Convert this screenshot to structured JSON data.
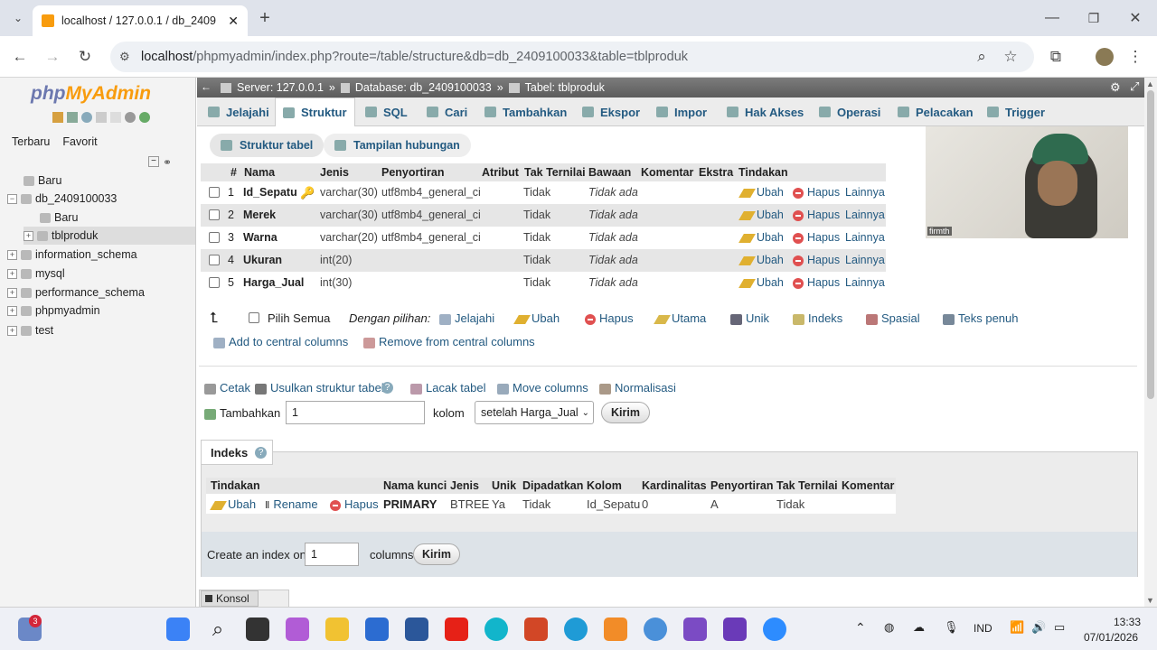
{
  "browser": {
    "tab_title": "localhost / 127.0.0.1 / db_2409",
    "url_host": "localhost",
    "url_path": "/phpmyadmin/index.php?route=/table/structure&db=db_2409100033&table=tblproduk"
  },
  "sidebar": {
    "logo_php": "php",
    "logo_my": "MyAdmin",
    "tabs": [
      "Terbaru",
      "Favorit"
    ],
    "tree": [
      "Baru",
      "db_2409100033",
      "Baru",
      "tblproduk",
      "information_schema",
      "mysql",
      "performance_schema",
      "phpmyadmin",
      "test"
    ]
  },
  "breadcrumb": {
    "server": "Server: 127.0.0.1",
    "database": "Database: db_2409100033",
    "table": "Tabel: tblproduk",
    "sep": "»"
  },
  "menu": [
    "Jelajahi",
    "Struktur",
    "SQL",
    "Cari",
    "Tambahkan",
    "Ekspor",
    "Impor",
    "Hak Akses",
    "Operasi",
    "Pelacakan",
    "Trigger"
  ],
  "subtabs": [
    "Struktur tabel",
    "Tampilan hubungan"
  ],
  "structure": {
    "headers": [
      "#",
      "Nama",
      "Jenis",
      "Penyortiran",
      "Atribut",
      "Tak Ternilai",
      "Bawaan",
      "Komentar",
      "Ekstra",
      "Tindakan"
    ],
    "rows": [
      {
        "num": "1",
        "name": "Id_Sepatu",
        "type": "varchar(30)",
        "collation": "utf8mb4_general_ci",
        "null": "Tidak",
        "default": "Tidak ada"
      },
      {
        "num": "2",
        "name": "Merek",
        "type": "varchar(30)",
        "collation": "utf8mb4_general_ci",
        "null": "Tidak",
        "default": "Tidak ada"
      },
      {
        "num": "3",
        "name": "Warna",
        "type": "varchar(20)",
        "collation": "utf8mb4_general_ci",
        "null": "Tidak",
        "default": "Tidak ada"
      },
      {
        "num": "4",
        "name": "Ukuran",
        "type": "int(20)",
        "collation": "",
        "null": "Tidak",
        "default": "Tidak ada"
      },
      {
        "num": "5",
        "name": "Harga_Jual",
        "type": "int(30)",
        "collation": "",
        "null": "Tidak",
        "default": "Tidak ada"
      }
    ],
    "actions": {
      "edit": "Ubah",
      "drop": "Hapus",
      "more": "Lainnya"
    }
  },
  "bulk": {
    "check_all": "Pilih Semua",
    "with_selected": "Dengan pilihan:",
    "actions": [
      "Jelajahi",
      "Ubah",
      "Hapus",
      "Utama",
      "Unik",
      "Indeks",
      "Spasial",
      "Teks penuh"
    ],
    "central_add": "Add to central columns",
    "central_remove": "Remove from central columns"
  },
  "tools": [
    "Cetak",
    "Usulkan struktur tabel",
    "Lacak tabel",
    "Move columns",
    "Normalisasi"
  ],
  "add_column": {
    "label": "Tambahkan",
    "value": "1",
    "unit": "kolom",
    "position": "setelah Harga_Jual",
    "submit": "Kirim"
  },
  "indexes": {
    "title": "Indeks",
    "headers": [
      "Tindakan",
      "Nama kunci",
      "Jenis",
      "Unik",
      "Dipadatkan",
      "Kolom",
      "Kardinalitas",
      "Penyortiran",
      "Tak Ternilai",
      "Komentar"
    ],
    "row": {
      "edit": "Ubah",
      "rename": "Rename",
      "drop": "Hapus",
      "key": "PRIMARY",
      "type": "BTREE",
      "unique": "Ya",
      "packed": "Tidak",
      "column": "Id_Sepatu",
      "cardinality": "0",
      "collation": "A",
      "null": "Tidak",
      "comment": ""
    },
    "create_label": "Create an index on",
    "create_value": "1",
    "create_unit": "columns",
    "submit": "Kirim"
  },
  "console": "Konsol",
  "webcam_label": "firmth",
  "taskbar": {
    "badge": "3",
    "lang": "IND",
    "time": "13:33",
    "date": "07/01/2026"
  }
}
